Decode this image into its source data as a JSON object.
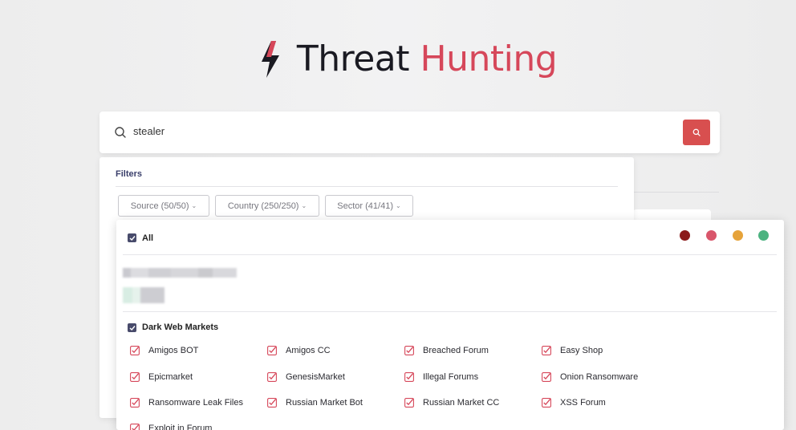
{
  "brand": {
    "title_primary": "Threat",
    "title_accent": "Hunting",
    "accent_color": "#d6475a"
  },
  "search": {
    "query": "stealer",
    "button_color": "#d84f4f"
  },
  "filters": {
    "title": "Filters",
    "chips": [
      {
        "label": "Source (50/50)"
      },
      {
        "label": "Country (250/250)"
      },
      {
        "label": "Sector (41/41)"
      }
    ]
  },
  "dropdown": {
    "all_label": "All",
    "severity_colors": [
      "#8b1a1a",
      "#d9566b",
      "#e6a33a",
      "#4cb380"
    ],
    "group_label": "Dark Web Markets",
    "items": [
      {
        "label": "Amigos BOT"
      },
      {
        "label": "Amigos CC"
      },
      {
        "label": "Breached Forum"
      },
      {
        "label": "Easy Shop"
      },
      {
        "label": "Epicmarket"
      },
      {
        "label": "GenesisMarket"
      },
      {
        "label": "Illegal Forums"
      },
      {
        "label": "Onion Ransomware"
      },
      {
        "label": "Ransomware Leak Files"
      },
      {
        "label": "Russian Market Bot"
      },
      {
        "label": "Russian Market CC"
      },
      {
        "label": "XSS Forum"
      },
      {
        "label": "Exploit in Forum"
      }
    ]
  }
}
